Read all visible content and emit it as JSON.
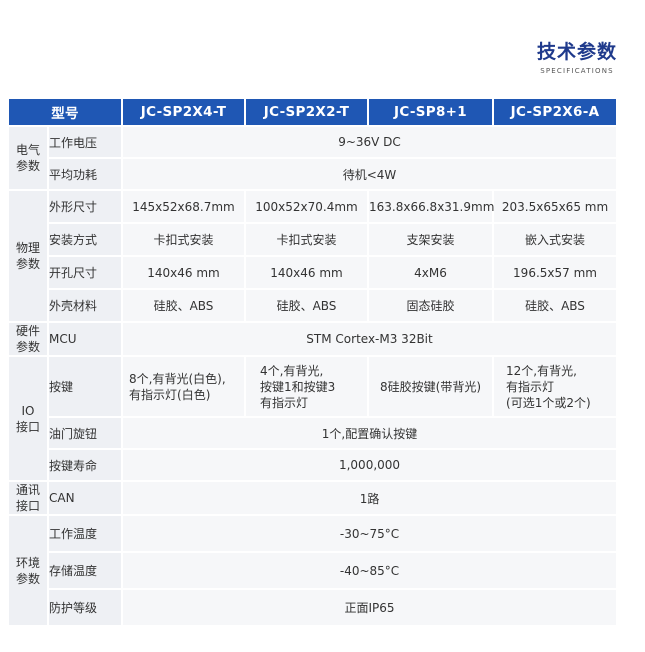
{
  "header": {
    "title": "技术参数",
    "subtitle": "SPECIFICATIONS"
  },
  "table": {
    "model_label": "型号",
    "models": [
      "JC-SP2X4-T",
      "JC-SP2X2-T",
      "JC-SP8+1",
      "JC-SP2X6-A"
    ],
    "categories": {
      "electrical": "电气\n参数",
      "physical": "物理\n参数",
      "hardware": "硬件\n参数",
      "io": "IO\n接口",
      "comm": "通讯\n接口",
      "env": "环境\n参数"
    },
    "rows": {
      "voltage": {
        "label": "工作电压",
        "value": "9~36V DC"
      },
      "power": {
        "label": "平均功耗",
        "value": "待机<4W"
      },
      "size": {
        "label": "外形尺寸",
        "values": [
          "145x52x68.7mm",
          "100x52x70.4mm",
          "163.8x66.8x31.9mm",
          "203.5x65x65 mm"
        ]
      },
      "mount": {
        "label": "安装方式",
        "values": [
          "卡扣式安装",
          "卡扣式安装",
          "支架安装",
          "嵌入式安装"
        ]
      },
      "cutout": {
        "label": "开孔尺寸",
        "values": [
          "140x46 mm",
          "140x46 mm",
          "4xM6",
          "196.5x57 mm"
        ]
      },
      "material": {
        "label": "外壳材料",
        "values": [
          "硅胶、ABS",
          "硅胶、ABS",
          "固态硅胶",
          "硅胶、ABS"
        ]
      },
      "mcu": {
        "label": "MCU",
        "value": "STM Cortex-M3 32Bit"
      },
      "keys": {
        "label": "按键",
        "values": [
          "8个,有背光(白色),\n有指示灯(白色)",
          "4个,有背光,\n按键1和按键3\n有指示灯",
          "8硅胶按键(带背光)",
          "12个,有背光,\n有指示灯\n(可选1个或2个)"
        ]
      },
      "knob": {
        "label": "油门旋钮",
        "value": "1个,配置确认按键"
      },
      "key_life": {
        "label": "按键寿命",
        "value": "1,000,000"
      },
      "can": {
        "label": "CAN",
        "value": "1路"
      },
      "op_temp": {
        "label": "工作温度",
        "value": "-30~75°C"
      },
      "storage_temp": {
        "label": "存储温度",
        "value": "-40~85°C"
      },
      "protection": {
        "label": "防护等级",
        "value": "正面IP65"
      }
    }
  }
}
